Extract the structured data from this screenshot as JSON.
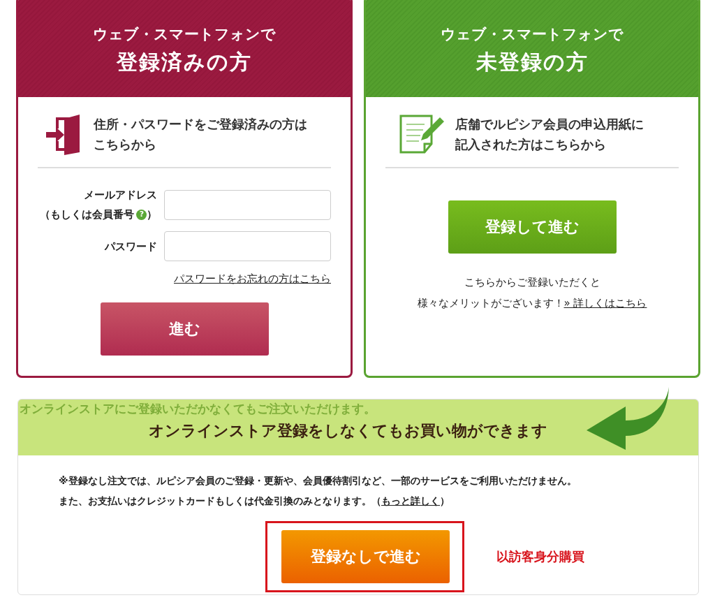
{
  "login_panel": {
    "heading": "ウェブ・スマートフォンで",
    "title": "登録済みの方",
    "intro": [
      "住所・パスワードをご登録済みの方は",
      "こちらから"
    ],
    "email_field": {
      "label": "メールアドレス",
      "note_before": "（もしくは会員番号",
      "help": "?",
      "note_after": "）"
    },
    "password_field": {
      "label": "パスワード"
    },
    "forgot_link": "パスワードをお忘れの方はこちら",
    "submit_button": "進む"
  },
  "signup_panel": {
    "heading": "ウェブ・スマートフォンで",
    "title": "未登録の方",
    "intro": [
      "店舗でルピシア会員の申込用紙に",
      "記入された方はこちらから"
    ],
    "register_button": "登録して進む",
    "benefit_note": [
      "こちらからご登録いただくと",
      "様々なメリットがございます！"
    ],
    "details_link": "» 詳しくはこちら"
  },
  "guest_panel": {
    "faded_text": "オンラインストアにご登録いただかなくてもご注文いただけます。",
    "title": "オンラインストア登録をしなくてもお買い物ができます",
    "notice": [
      "※登録なし注文では、ルピシア会員のご登録・更新や、会員優待割引など、一部のサービスをご利用いただけません。",
      "また、お支払いはクレジットカードもしくは代金引換のみとなります。（"
    ],
    "notice_link": "もっと詳しく",
    "notice_end": "）",
    "guest_button": "登録なしで進む",
    "annotation": "以訪客身分購買"
  }
}
